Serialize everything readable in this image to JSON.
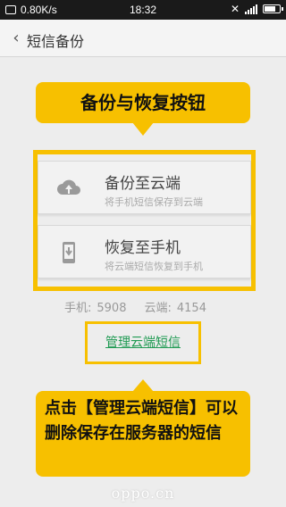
{
  "status_bar": {
    "speed": "0.80K/s",
    "time": "18:32",
    "battery_level": 0.85
  },
  "header": {
    "back_icon": "chevron-left-icon",
    "title": "短信备份"
  },
  "callouts": {
    "top": "备份与恢复按钮",
    "bottom": "点击【管理云端短信】可以删除保存在服务器的短信"
  },
  "buttons": {
    "backup": {
      "icon": "cloud-upload-icon",
      "title": "备份至云端",
      "subtitle": "将手机短信保存到云端"
    },
    "restore": {
      "icon": "phone-download-icon",
      "title": "恢复至手机",
      "subtitle": "将云端短信恢复到手机"
    }
  },
  "counts": {
    "phone_label": "手机:",
    "phone_value": "5908",
    "cloud_label": "云端:",
    "cloud_value": "4154"
  },
  "manage_link": "管理云端短信",
  "watermark": "oppo.cn",
  "colors": {
    "accent_yellow": "#f7c000",
    "link_green": "#1f9a52"
  }
}
